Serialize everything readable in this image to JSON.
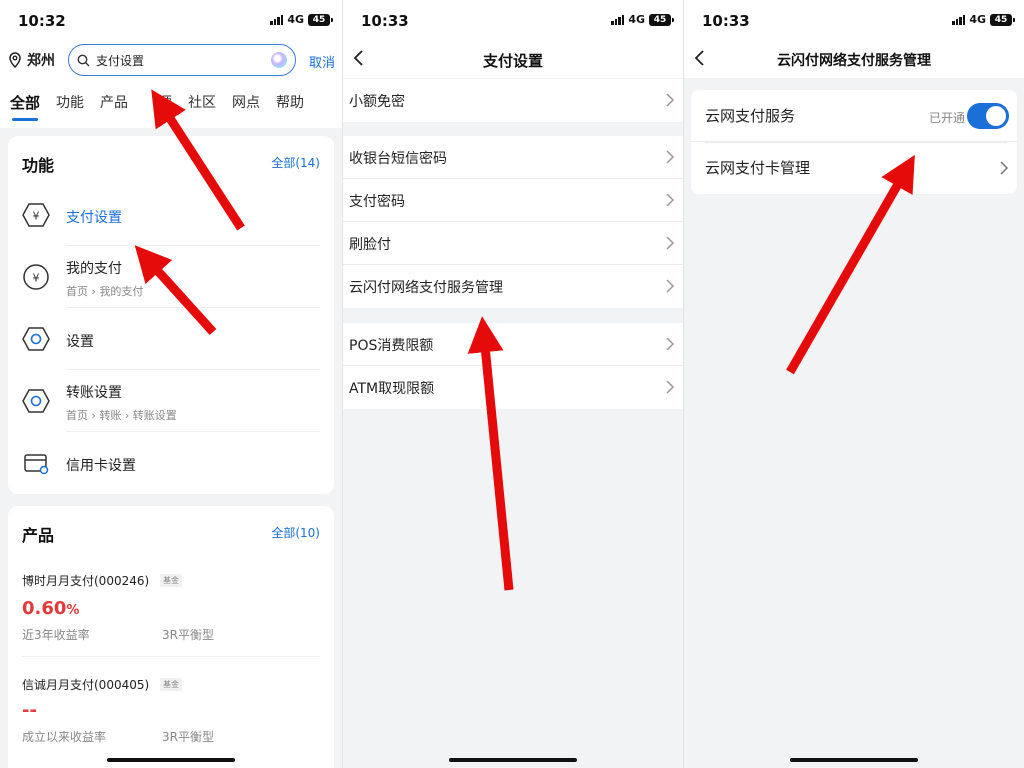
{
  "colors": {
    "accent": "#1a6fd9",
    "value_red": "#e23a3a",
    "arrow": "#e60b0b"
  },
  "panel1": {
    "time": "10:32",
    "network": "4G",
    "battery": "45",
    "location": "郑州",
    "search": {
      "value": "支付设置"
    },
    "cancel": "取消",
    "tabs": [
      "全部",
      "功能",
      "产品",
      "",
      "社区",
      "网点",
      "帮助"
    ],
    "tabs_partial": "源",
    "functions": {
      "title": "功能",
      "more": "全部(14)",
      "items": [
        {
          "title": "支付设置",
          "sub": "",
          "icon": "yuan-hexagon-icon"
        },
        {
          "title": "我的支付",
          "sub": "首页 › 我的支付",
          "icon": "yuan-circle-icon"
        },
        {
          "title": "设置",
          "sub": "",
          "icon": "hexagon-icon"
        },
        {
          "title": "转账设置",
          "sub": "首页 › 转账 › 转账设置",
          "icon": "hexagon-icon"
        },
        {
          "title": "信用卡设置",
          "sub": "",
          "icon": "credit-card-icon"
        }
      ]
    },
    "products": {
      "title": "产品",
      "more": "全部(10)",
      "items": [
        {
          "name": "博时月月支付(000246)",
          "tag": "基金",
          "value": "0.60",
          "unit": "%",
          "label": "近3年收益率",
          "risk": "3R平衡型"
        },
        {
          "name": "信诚月月支付(000405)",
          "tag": "基金",
          "value": "--",
          "unit": "",
          "label": "成立以来收益率",
          "risk": "3R平衡型"
        }
      ]
    }
  },
  "panel2": {
    "time": "10:33",
    "network": "4G",
    "battery": "45",
    "title": "支付设置",
    "groups": [
      [
        "小额免密"
      ],
      [
        "收银台短信密码",
        "支付密码",
        "刷脸付",
        "云闪付网络支付服务管理"
      ],
      [
        "POS消费限额",
        "ATM取现限额"
      ]
    ]
  },
  "panel3": {
    "time": "10:33",
    "network": "4G",
    "battery": "45",
    "title": "云闪付网络支付服务管理",
    "service": {
      "label": "云网支付服务",
      "status": "已开通",
      "enabled": true
    },
    "card_mgmt": "云网支付卡管理"
  }
}
